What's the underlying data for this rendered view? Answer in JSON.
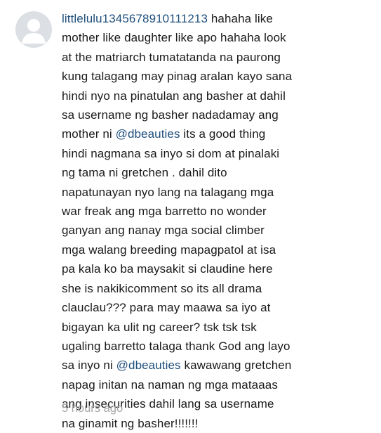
{
  "comment": {
    "avatar_icon": "default-user-avatar-icon",
    "username": "littlelulu1345678910111213",
    "segments": [
      {
        "type": "text",
        "value": " hahaha like\nmother like daughter like apo hahaha look\nat the matriarch tumatatanda na paurong\nkung talagang may pinag aralan kayo sana\nhindi nyo na pinatulan ang basher at dahil\nsa username ng basher nadadamay ang\nmother ni "
      },
      {
        "type": "mention",
        "value": "@dbeauties"
      },
      {
        "type": "text",
        "value": " its a good thing\nhindi nagmana sa inyo si dom at pinalaki\nng tama ni gretchen . dahil dito\nnapatunayan nyo lang na talagang mga\nwar freak ang mga barretto no wonder\nganyan ang nanay mga social climber\nmga walang breeding mapagpatol at isa\npa kala ko ba maysakit si claudine here\nshe is nakikicomment so its all drama\nclauclau??? para may maawa sa iyo at\nbigayan ka ulit ng career? tsk tsk tsk\nugaling barretto talaga thank God ang layo\nsa inyo ni "
      },
      {
        "type": "mention",
        "value": "@dbeauties"
      },
      {
        "type": "text",
        "value": " kawawang gretchen\nnapag initan na naman ng mga mataaas\nang insecurities dahil lang sa username\nna ginamit ng basher!!!!!!!"
      }
    ],
    "timestamp": "5 hours ago"
  },
  "colors": {
    "username": "#1f4f7c",
    "mention": "#1f4f7c",
    "text": "#1a1a1a",
    "timestamp": "#a6a6a6",
    "avatar_bg": "#dcdfe3",
    "avatar_figure": "#ffffff"
  }
}
